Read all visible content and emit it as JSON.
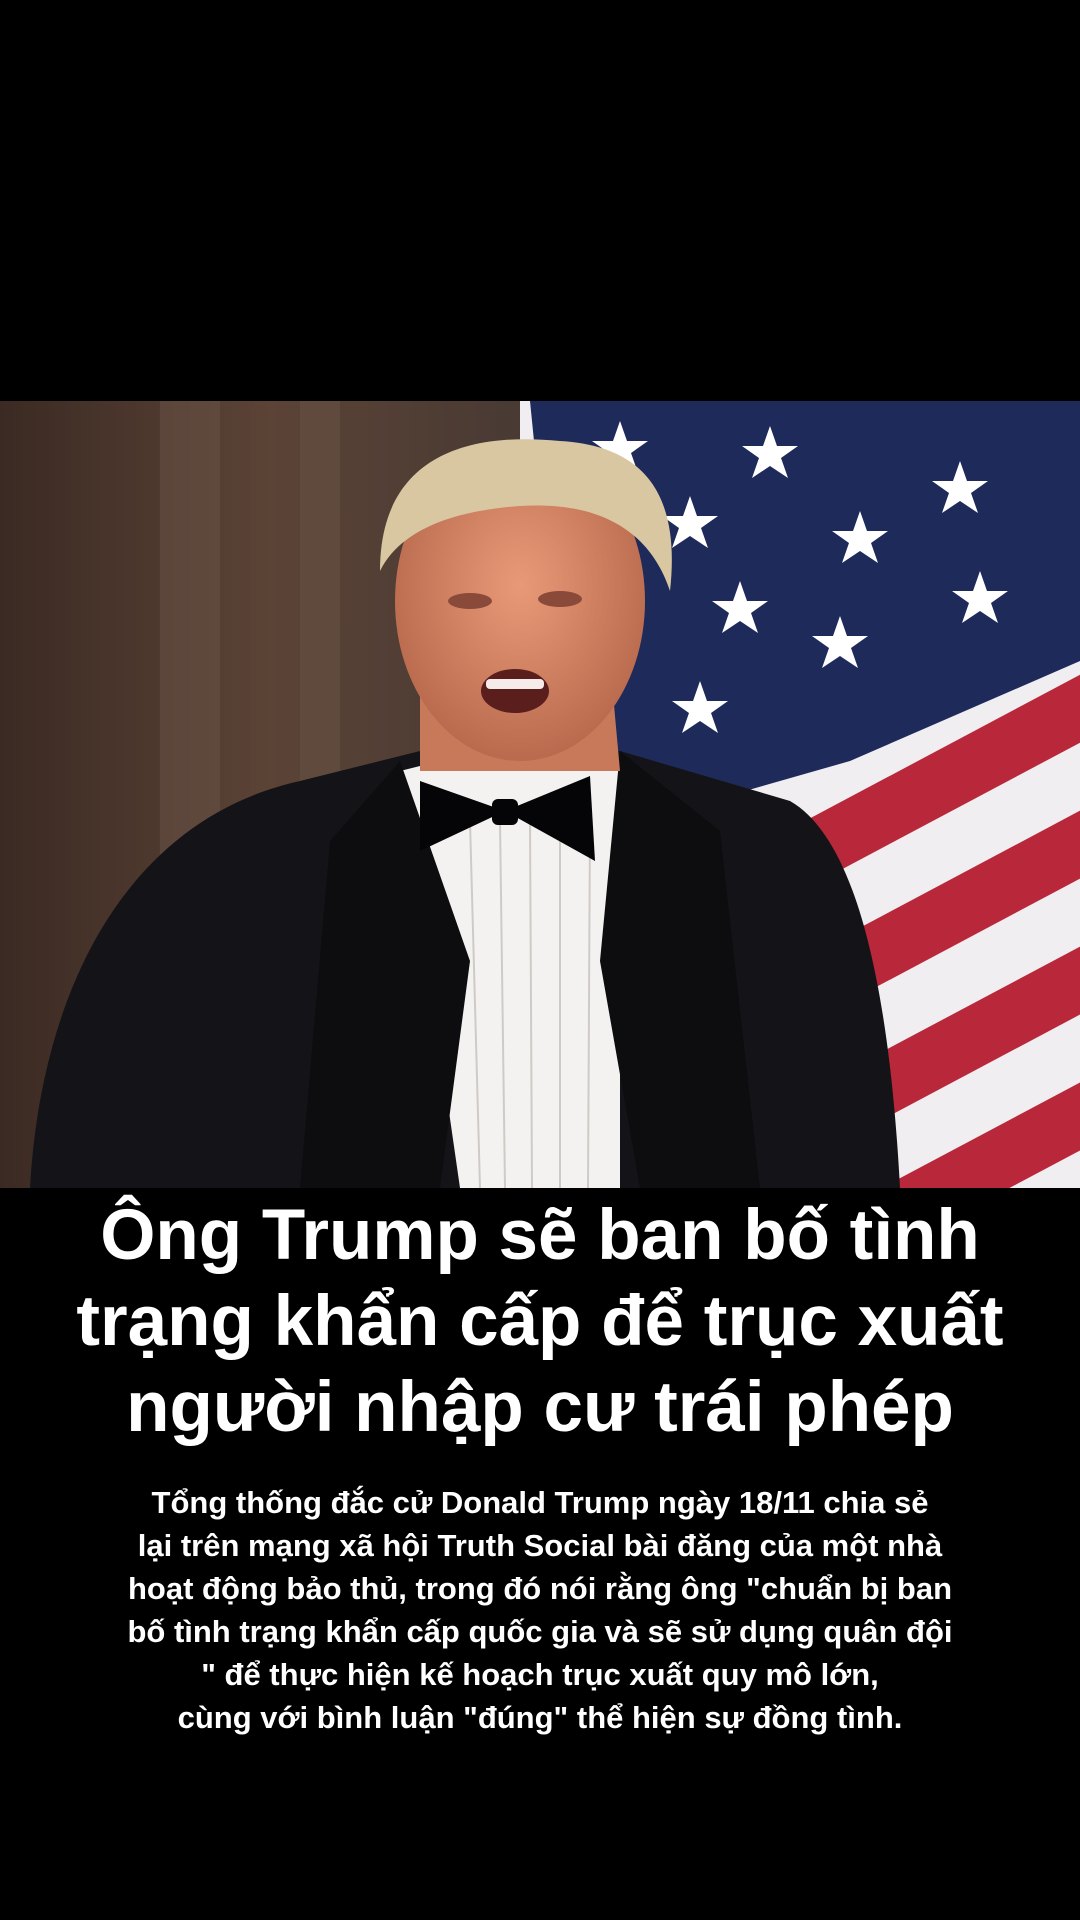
{
  "photo": {
    "subject_icon": "person-in-tuxedo-photo",
    "flag_icon": "us-flag-icon",
    "colors": {
      "flag_blue": "#1e2a5a",
      "flag_red": "#b8283a",
      "flag_white": "#f0eef0",
      "suit": "#141418",
      "backdrop": "#4a382f"
    }
  },
  "headline": {
    "lines": [
      "Ông Trump sẽ ban bố tình",
      "trạng khẩn cấp để trục xuất",
      "người nhập cư trái phép"
    ]
  },
  "body": {
    "lines": [
      "Tổng thống đắc cử Donald Trump ngày 18/11 chia sẻ",
      "lại trên mạng xã hội Truth Social bài đăng của một nhà",
      "hoạt động bảo thủ, trong đó nói rằng ông \"chuẩn bị ban",
      "bố tình trạng khẩn cấp quốc gia và sẽ sử dụng quân đội",
      "\" để thực hiện kế hoạch trục xuất quy mô lớn,",
      "cùng với bình luận \"đúng\" thể hiện sự đồng tình."
    ]
  }
}
